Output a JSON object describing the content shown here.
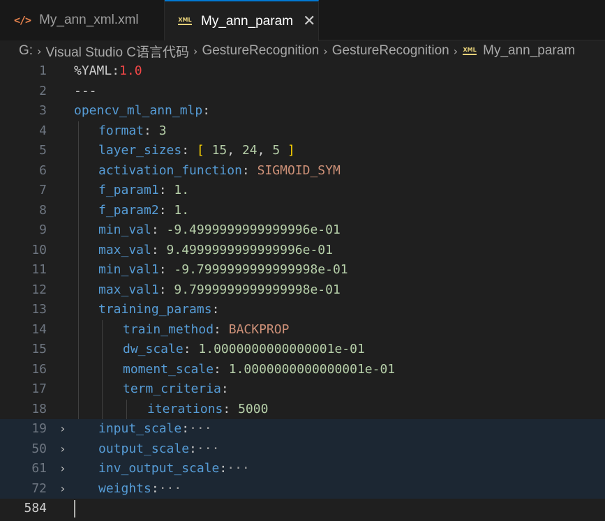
{
  "tabs": [
    {
      "label": "My_ann_xml.xml",
      "icon": "code-brackets-icon",
      "active": false
    },
    {
      "label": "My_ann_param",
      "icon": "xml-file-icon",
      "active": true,
      "close_glyph": "✕"
    }
  ],
  "breadcrumb": {
    "items": [
      "G:",
      "Visual Studio C语言代码",
      "GestureRecognition",
      "GestureRecognition",
      "My_ann_param"
    ],
    "separator": "›"
  },
  "icon_text": {
    "xml": "XML",
    "code": "</>"
  },
  "editor": {
    "lines": [
      {
        "n": "1",
        "parts": [
          {
            "t": "%YAML",
            "c": "plain"
          },
          {
            "t": ":",
            "c": "plain"
          },
          {
            "t": "1.0",
            "c": "red"
          }
        ]
      },
      {
        "n": "2",
        "parts": [
          {
            "t": "---",
            "c": "plain"
          }
        ]
      },
      {
        "n": "3",
        "parts": [
          {
            "t": "opencv_ml_ann_mlp",
            "c": "key"
          },
          {
            "t": ":",
            "c": "plain"
          }
        ]
      },
      {
        "n": "4",
        "parts": [
          {
            "t": "format",
            "c": "key"
          },
          {
            "t": ": ",
            "c": "plain"
          },
          {
            "t": "3",
            "c": "num"
          }
        ]
      },
      {
        "n": "5",
        "parts": [
          {
            "t": "layer_sizes",
            "c": "key"
          },
          {
            "t": ": ",
            "c": "plain"
          },
          {
            "t": "[",
            "c": "brk"
          },
          {
            "t": " 15",
            "c": "num"
          },
          {
            "t": ", ",
            "c": "plain"
          },
          {
            "t": "24",
            "c": "num"
          },
          {
            "t": ", ",
            "c": "plain"
          },
          {
            "t": "5 ",
            "c": "num"
          },
          {
            "t": "]",
            "c": "brk"
          }
        ]
      },
      {
        "n": "6",
        "parts": [
          {
            "t": "activation_function",
            "c": "key"
          },
          {
            "t": ": ",
            "c": "plain"
          },
          {
            "t": "SIGMOID_SYM",
            "c": "str"
          }
        ]
      },
      {
        "n": "7",
        "parts": [
          {
            "t": "f_param1",
            "c": "key"
          },
          {
            "t": ": ",
            "c": "plain"
          },
          {
            "t": "1.",
            "c": "num"
          }
        ]
      },
      {
        "n": "8",
        "parts": [
          {
            "t": "f_param2",
            "c": "key"
          },
          {
            "t": ": ",
            "c": "plain"
          },
          {
            "t": "1.",
            "c": "num"
          }
        ]
      },
      {
        "n": "9",
        "parts": [
          {
            "t": "min_val",
            "c": "key"
          },
          {
            "t": ": ",
            "c": "plain"
          },
          {
            "t": "-9.4999999999999996e-01",
            "c": "num"
          }
        ]
      },
      {
        "n": "10",
        "parts": [
          {
            "t": "max_val",
            "c": "key"
          },
          {
            "t": ": ",
            "c": "plain"
          },
          {
            "t": "9.4999999999999996e-01",
            "c": "num"
          }
        ]
      },
      {
        "n": "11",
        "parts": [
          {
            "t": "min_val1",
            "c": "key"
          },
          {
            "t": ": ",
            "c": "plain"
          },
          {
            "t": "-9.7999999999999998e-01",
            "c": "num"
          }
        ]
      },
      {
        "n": "12",
        "parts": [
          {
            "t": "max_val1",
            "c": "key"
          },
          {
            "t": ": ",
            "c": "plain"
          },
          {
            "t": "9.7999999999999998e-01",
            "c": "num"
          }
        ]
      },
      {
        "n": "13",
        "parts": [
          {
            "t": "training_params",
            "c": "key"
          },
          {
            "t": ":",
            "c": "plain"
          }
        ]
      },
      {
        "n": "14",
        "parts": [
          {
            "t": "train_method",
            "c": "key"
          },
          {
            "t": ": ",
            "c": "plain"
          },
          {
            "t": "BACKPROP",
            "c": "str"
          }
        ]
      },
      {
        "n": "15",
        "parts": [
          {
            "t": "dw_scale",
            "c": "key"
          },
          {
            "t": ": ",
            "c": "plain"
          },
          {
            "t": "1.0000000000000001e-01",
            "c": "num"
          }
        ]
      },
      {
        "n": "16",
        "parts": [
          {
            "t": "moment_scale",
            "c": "key"
          },
          {
            "t": ": ",
            "c": "plain"
          },
          {
            "t": "1.0000000000000001e-01",
            "c": "num"
          }
        ]
      },
      {
        "n": "17",
        "parts": [
          {
            "t": "term_criteria",
            "c": "key"
          },
          {
            "t": ":",
            "c": "plain"
          }
        ]
      },
      {
        "n": "18",
        "parts": [
          {
            "t": "iterations",
            "c": "key"
          },
          {
            "t": ": ",
            "c": "plain"
          },
          {
            "t": "5000",
            "c": "num"
          }
        ]
      },
      {
        "n": "19",
        "folded": true,
        "parts": [
          {
            "t": "input_scale",
            "c": "key"
          },
          {
            "t": ":",
            "c": "plain"
          },
          {
            "t": "···",
            "c": "dots"
          }
        ]
      },
      {
        "n": "50",
        "folded": true,
        "parts": [
          {
            "t": "output_scale",
            "c": "key"
          },
          {
            "t": ":",
            "c": "plain"
          },
          {
            "t": "···",
            "c": "dots"
          }
        ]
      },
      {
        "n": "61",
        "folded": true,
        "parts": [
          {
            "t": "inv_output_scale",
            "c": "key"
          },
          {
            "t": ":",
            "c": "plain"
          },
          {
            "t": "···",
            "c": "dots"
          }
        ]
      },
      {
        "n": "72",
        "folded": true,
        "parts": [
          {
            "t": "weights",
            "c": "key"
          },
          {
            "t": ":",
            "c": "plain"
          },
          {
            "t": "···",
            "c": "dots"
          }
        ]
      },
      {
        "n": "584",
        "cursor": true,
        "parts": []
      }
    ]
  },
  "colors": {
    "background": "#1f1f1f",
    "tab_active_border": "#0078d4",
    "key": "#569cd6",
    "string": "#ce9178",
    "number": "#b5cea8",
    "version": "#f44747",
    "bracket": "#ffd700"
  }
}
